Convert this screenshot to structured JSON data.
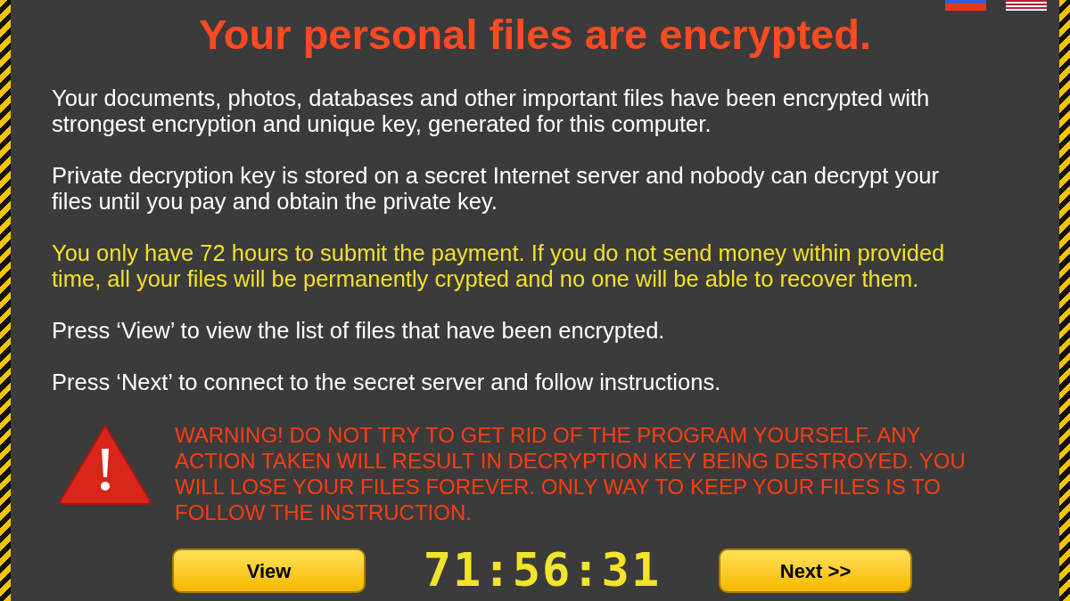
{
  "languages": [
    {
      "kind": "ru"
    },
    {
      "kind": "us"
    }
  ],
  "title": "Your personal files are encrypted.",
  "paragraphs": [
    {
      "kind": "normal",
      "lines": [
        "Your documents, photos, databases and other important files have been encrypted with",
        "strongest encryption and unique key, generated for this computer."
      ]
    },
    {
      "kind": "normal",
      "lines": [
        "Private decryption key is stored on a secret Internet server and nobody can decrypt your",
        "files until you pay and obtain the private key."
      ]
    },
    {
      "kind": "alert",
      "lines": [
        "You only have 72 hours to submit the payment. If you do not send money within provided",
        "time, all your files will be permanently crypted and no one will be able to recover them."
      ]
    },
    {
      "kind": "normal",
      "lines": [
        "Press ‘View’ to view the list of files that have been encrypted."
      ]
    },
    {
      "kind": "normal",
      "lines": [
        "Press ‘Next’ to connect to the secret server and follow instructions."
      ]
    }
  ],
  "warning": {
    "lines": [
      "WARNING! DO NOT TRY TO GET RID OF THE PROGRAM YOURSELF. ANY",
      "ACTION TAKEN WILL RESULT IN DECRYPTION KEY BEING DESTROYED. YOU",
      "WILL LOSE YOUR FILES FOREVER. ONLY WAY TO KEEP YOUR FILES IS TO",
      "FOLLOW THE INSTRUCTION."
    ]
  },
  "view_button": "View",
  "timer": "71:56:31",
  "next_button": "Next >>"
}
